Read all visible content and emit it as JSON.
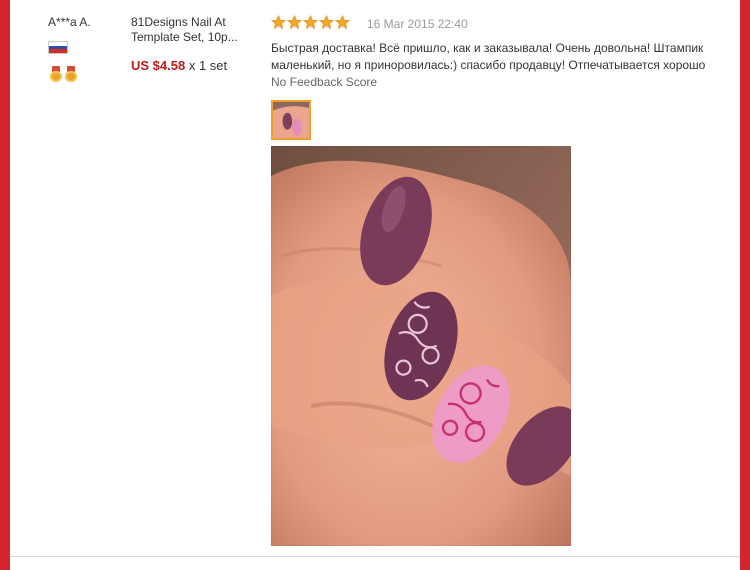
{
  "buyer": {
    "name": "A***a A.",
    "country_flag": "russia-flag-icon",
    "medals": [
      "gold-medal-icon",
      "gold-medal-icon"
    ]
  },
  "product": {
    "title": "81Designs Nail At Template Set, 10p...",
    "price": "US $4.58",
    "quantity": "x 1 set"
  },
  "review": {
    "rating": 5,
    "date": "16 Mar 2015 22:40",
    "text": "Быстрая доставка! Всё пришло, как и заказывала! Очень довольна! Штампик маленький, но я приноровилась:)  спасибо продавцу! Отпечатывается хорошо",
    "feedback_score": "No Feedback Score"
  },
  "colors": {
    "frame_red": "#d6242f",
    "price_red": "#bd1a1d",
    "star_orange": "#f5a623",
    "thumb_border": "#f0a028"
  }
}
